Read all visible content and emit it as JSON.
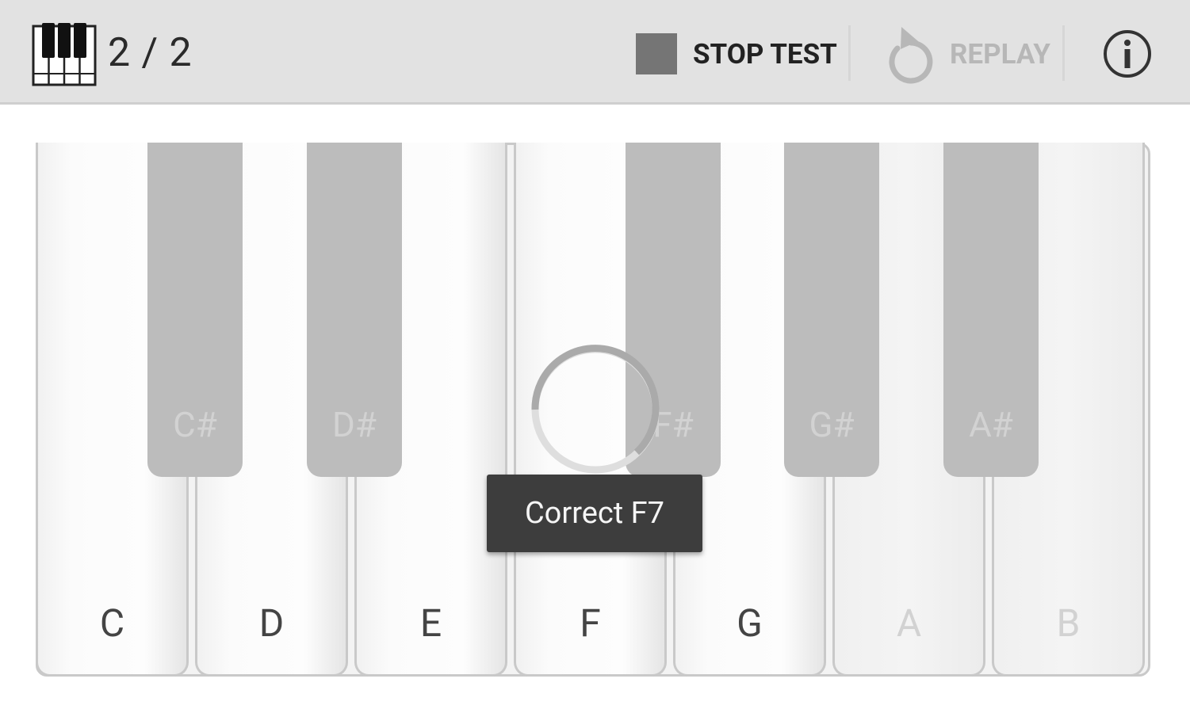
{
  "toolbar": {
    "progress": "2 / 2",
    "stop_label": "STOP TEST",
    "replay_label": "REPLAY",
    "app_icon": "piano-keys-icon",
    "stop_icon": "stop-square-icon",
    "replay_icon": "replay-arrow-icon",
    "info_icon": "info-circle-icon"
  },
  "keyboard": {
    "white_keys": [
      {
        "label": "C",
        "enabled": true
      },
      {
        "label": "D",
        "enabled": true
      },
      {
        "label": "E",
        "enabled": true
      },
      {
        "label": "F",
        "enabled": true
      },
      {
        "label": "G",
        "enabled": true
      },
      {
        "label": "A",
        "enabled": false
      },
      {
        "label": "B",
        "enabled": false
      }
    ],
    "black_keys": [
      {
        "label": "C#"
      },
      {
        "label": "D#"
      },
      {
        "label": "F#"
      },
      {
        "label": "G#"
      },
      {
        "label": "A#"
      }
    ]
  },
  "toast": {
    "message": "Correct F7"
  },
  "colors": {
    "toolbar_bg": "#e2e2e2",
    "black_key": "#bcbcbc",
    "toast_bg": "#3d3d3d",
    "stop_square": "#757575"
  }
}
